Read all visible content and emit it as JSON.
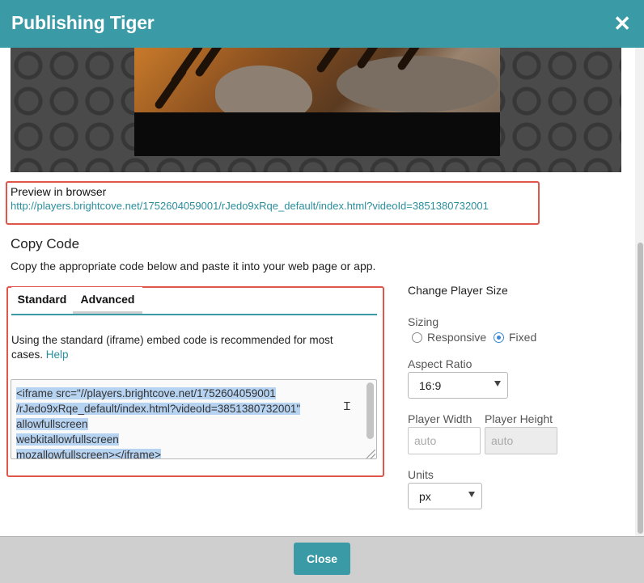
{
  "dialog": {
    "title": "Publishing Tiger",
    "close_icon": "close-icon"
  },
  "preview": {
    "label": "Preview in browser",
    "url": "http://players.brightcove.net/1752604059001/rJedo9xRqe_default/index.html?videoId=3851380732001"
  },
  "copy_code": {
    "heading": "Copy Code",
    "description": "Copy the appropriate code below and paste it into your web page or app.",
    "tabs": [
      {
        "label": "Standard",
        "active": true
      },
      {
        "label": "Advanced",
        "active": false
      }
    ],
    "standard_desc": "Using the standard (iframe) embed code is recommended for most cases.",
    "help_label": "Help",
    "code_lines": [
      "<iframe src=\"//players.brightcove.net/1752604059001",
      "/rJedo9xRqe_default/index.html?videoId=3851380732001\"",
      "allowfullscreen",
      "webkitallowfullscreen",
      "mozallowfullscreen></iframe>"
    ]
  },
  "player_size": {
    "title": "Change Player Size",
    "sizing_label": "Sizing",
    "sizing_options": [
      {
        "label": "Responsive",
        "checked": false
      },
      {
        "label": "Fixed",
        "checked": true
      }
    ],
    "aspect_ratio_label": "Aspect Ratio",
    "aspect_ratio_value": "16:9",
    "player_width_label": "Player Width",
    "player_width_placeholder": "auto",
    "player_height_label": "Player Height",
    "player_height_placeholder": "auto",
    "units_label": "Units",
    "units_value": "px"
  },
  "footer": {
    "close_label": "Close"
  },
  "colors": {
    "accent": "#3a9aa6",
    "highlight_border": "#e0564a",
    "link": "#2a8d9c"
  }
}
